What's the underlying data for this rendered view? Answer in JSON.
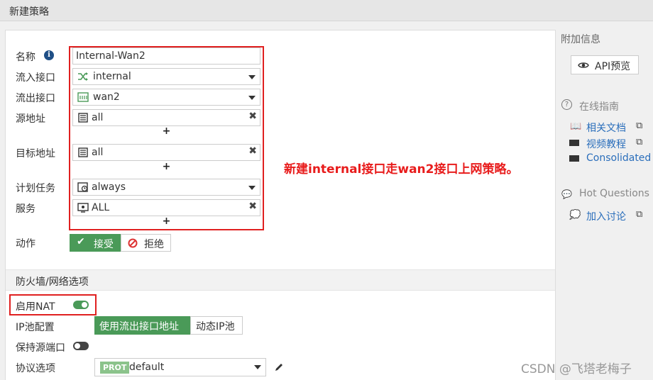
{
  "window": {
    "title": "新建策略"
  },
  "form": {
    "name": {
      "label": "名称",
      "value": "Internal-Wan2"
    },
    "incoming": {
      "label": "流入接口",
      "value": "internal"
    },
    "outgoing": {
      "label": "流出接口",
      "value": "wan2"
    },
    "source": {
      "label": "源地址",
      "value": "all"
    },
    "destination": {
      "label": "目标地址",
      "value": "all"
    },
    "schedule": {
      "label": "计划任务",
      "value": "always"
    },
    "service": {
      "label": "服务",
      "value": "ALL"
    },
    "plus": "+",
    "action": {
      "label": "动作",
      "accept": "接受",
      "deny": "拒绝",
      "selected": "accept"
    }
  },
  "firewall_section": {
    "title": "防火墙/网络选项",
    "nat": {
      "label": "启用NAT",
      "enabled": true
    },
    "ip_pool": {
      "label": "IP池配置",
      "option1": "使用流出接口地址",
      "option2": "动态IP池",
      "selected": "option1"
    },
    "preserve_port": {
      "label": "保持源端口",
      "enabled": false
    },
    "protocol": {
      "label": "协议选项",
      "badge": "PROT",
      "value": "default"
    }
  },
  "sidebar": {
    "title": "附加信息",
    "api_button": "API预览",
    "guide_title": "在线指南",
    "links": [
      "相关文档",
      "视频教程",
      "Consolidated P"
    ],
    "hot_title": "Hot Questions a",
    "discuss": "加入讨论"
  },
  "annotation": "新建internal接口走wan2接口上网策略。",
  "watermark": "CSDN @飞塔老梅子",
  "colors": {
    "accent_green": "#4a9a58",
    "annotation_red": "#e81c1c",
    "link_blue": "#2a6ebb"
  }
}
